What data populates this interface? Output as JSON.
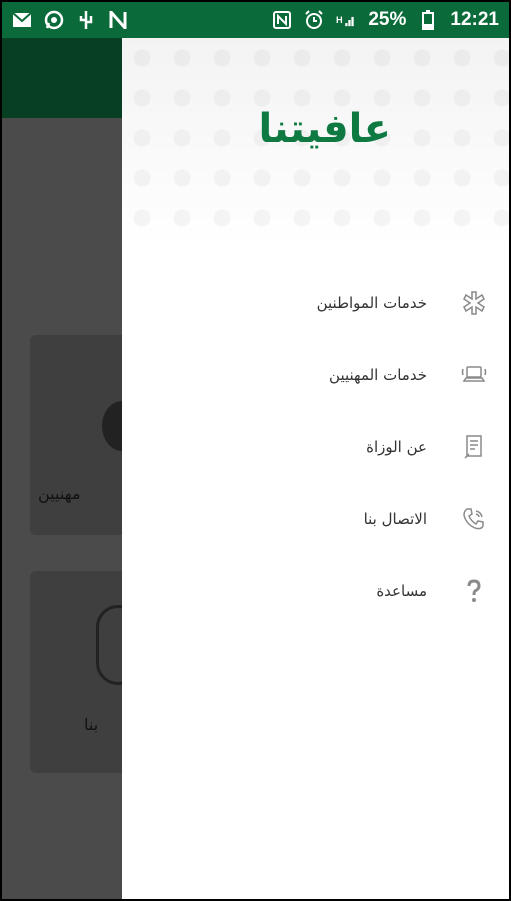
{
  "status_bar": {
    "battery": "25%",
    "time": "12:21",
    "left_icons": [
      "mail-icon",
      "whatsapp-icon",
      "usb-icon",
      "n-icon"
    ],
    "right_icons": [
      "nfc-icon",
      "alarm-icon",
      "signal-icon",
      "battery-icon"
    ]
  },
  "background_app": {
    "card_labels": [
      "مهنيين",
      "بنا"
    ]
  },
  "drawer": {
    "title": "عافيتنا",
    "items": [
      {
        "label": "خدمات المواطنين",
        "icon": "star-of-life-icon"
      },
      {
        "label": "خدمات المهنيين",
        "icon": "laptop-icon"
      },
      {
        "label": "عن الوزاة",
        "icon": "document-icon"
      },
      {
        "label": "الاتصال بنا",
        "icon": "phone-icon"
      },
      {
        "label": "مساعدة",
        "icon": "help-icon"
      }
    ]
  },
  "colors": {
    "status_bar": "#0b6a3a",
    "accent": "#0e7a42",
    "icon": "#8a8a8a"
  }
}
